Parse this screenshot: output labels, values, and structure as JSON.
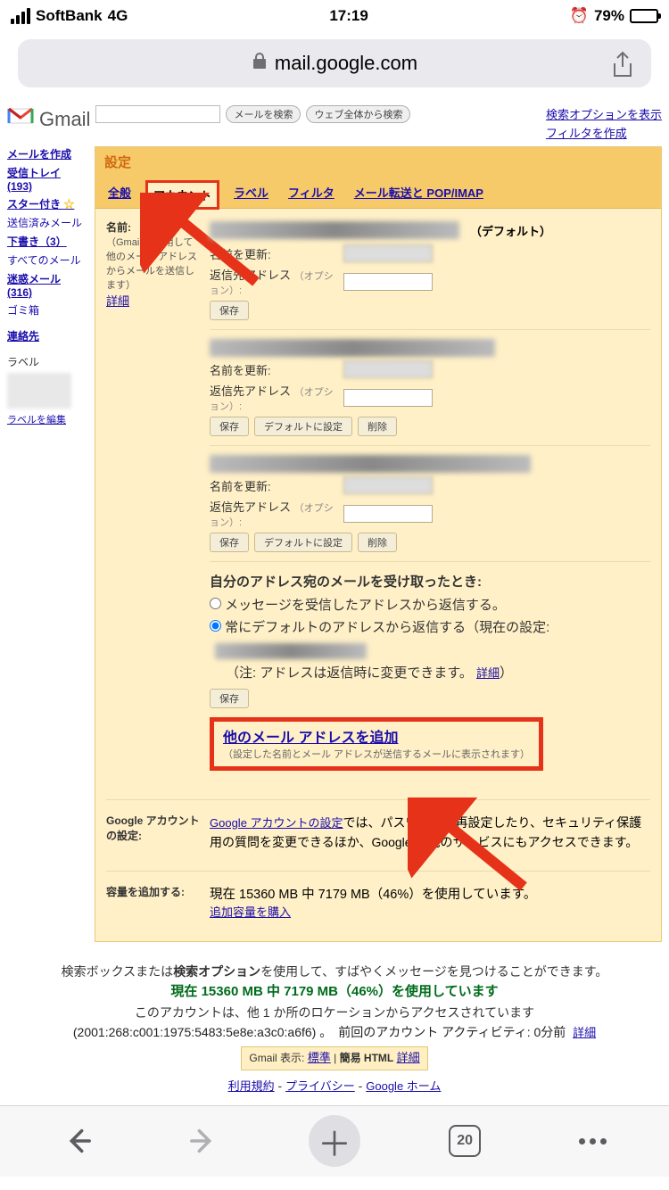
{
  "status": {
    "carrier": "SoftBank",
    "network": "4G",
    "time": "17:19",
    "battery_pct": "79%"
  },
  "url": "mail.google.com",
  "gmail_text": "Gmail",
  "header": {
    "search_btn": "メールを検索",
    "web_btn": "ウェブ全体から検索",
    "adv_search": "検索オプションを表示",
    "create_filter": "フィルタを作成"
  },
  "sidebar": {
    "compose": "メールを作成",
    "inbox": "受信トレイ (193)",
    "starred": "スター付き",
    "sent": "送信済みメール",
    "drafts": "下書き（3）",
    "all": "すべてのメール",
    "spam": "迷惑メール (316)",
    "trash": "ゴミ箱",
    "contacts": "連絡先",
    "labels_title": "ラベル",
    "edit_labels": "ラベルを編集"
  },
  "settings": {
    "title": "設定",
    "tabs": {
      "general": "全般",
      "account": "アカウント",
      "labels": "ラベル",
      "filter": "フィルタ",
      "forwarding": "メール転送と POP/IMAP"
    },
    "name_section": {
      "label": "名前:",
      "sub": "（Gmail を使用して他のメール アドレスからメールを送信します）",
      "detail": "詳細",
      "default_tag": "（デフォルト）",
      "update_name": "名前を更新:",
      "reply_to": "返信先アドレス",
      "optional": "（オプション）:",
      "save": "保存",
      "set_default": "デフォルトに設定",
      "delete": "削除"
    },
    "reply_section": {
      "heading": "自分のアドレス宛のメールを受け取ったとき:",
      "opt1": "メッセージを受信したアドレスから返信する。",
      "opt2": "常にデフォルトのアドレスから返信する（現在の設定:",
      "note_prefix": "（注: アドレスは返信時に変更できます。",
      "detail": "詳細",
      "note_suffix": "）",
      "save": "保存"
    },
    "add_addr": {
      "link": "他のメール アドレスを追加",
      "sub": "（設定した名前とメール アドレスが送信するメールに表示されます）"
    },
    "google_account": {
      "label": "Google アカウントの設定:",
      "link": "Google アカウントの設定",
      "text1": "では、パスワードを再設定したり、セキュリティ保護用の質問を変更できるほか、Google の他のサービスにもアクセスできます。"
    },
    "storage": {
      "label": "容量を追加する:",
      "line": "現在 15360 MB 中 7179 MB（46%）を使用しています。",
      "buy": "追加容量を購入"
    }
  },
  "footer": {
    "tip1": "検索ボックスまたは",
    "tip_bold": "検索オプション",
    "tip2": "を使用して、すばやくメッセージを見つけることができます。",
    "storage": "現在 15360 MB 中 7179 MB（46%）を使用しています",
    "access": "このアカウントは、他 1 か所のロケーションからアクセスされています",
    "ip": "(2001:268:c001:1975:5483:5e8e:a3c0:a6f6) 。　前回のアカウント アクティビティ: 0分前",
    "detail": "詳細",
    "display_prefix": "Gmail 表示:",
    "display_std": "標準",
    "display_html": "簡易 HTML",
    "display_detail": "詳細",
    "tos": "利用規約",
    "privacy": "プライバシー",
    "ghome": "Google ホーム"
  },
  "bottom_nav": {
    "tab_count": "20"
  }
}
